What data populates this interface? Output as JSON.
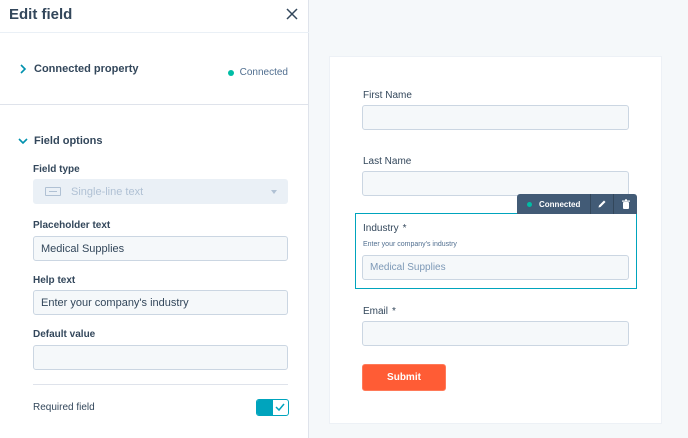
{
  "panel": {
    "title": "Edit field",
    "connected_section": {
      "label": "Connected property",
      "status": "Connected"
    },
    "options_section": {
      "label": "Field options"
    },
    "field_type": {
      "label": "Field type",
      "value": "Single-line text"
    },
    "placeholder": {
      "label": "Placeholder text",
      "value": "Medical Supplies"
    },
    "help_text": {
      "label": "Help text",
      "value": "Enter your company's industry"
    },
    "default_value": {
      "label": "Default value",
      "value": ""
    },
    "required": {
      "label": "Required field",
      "on": true
    }
  },
  "form": {
    "fields": [
      {
        "label": "First Name",
        "required": false,
        "placeholder": ""
      },
      {
        "label": "Last Name",
        "required": false,
        "placeholder": ""
      },
      {
        "label": "Industry",
        "required": true,
        "help": "Enter your company's industry",
        "placeholder": "Medical Supplies"
      },
      {
        "label": "Email",
        "required": true,
        "placeholder": ""
      }
    ],
    "toolbar": {
      "status": "Connected"
    },
    "submit_label": "Submit"
  },
  "colors": {
    "accent": "#00a4bd",
    "submit": "#ff5c35",
    "connected_dot": "#00bda5",
    "toolbar_bg": "#425b76"
  },
  "icons": [
    "close-icon",
    "chevron-right-icon",
    "chevron-down-icon",
    "text-field-icon",
    "pencil-icon",
    "trash-icon",
    "check-icon"
  ]
}
